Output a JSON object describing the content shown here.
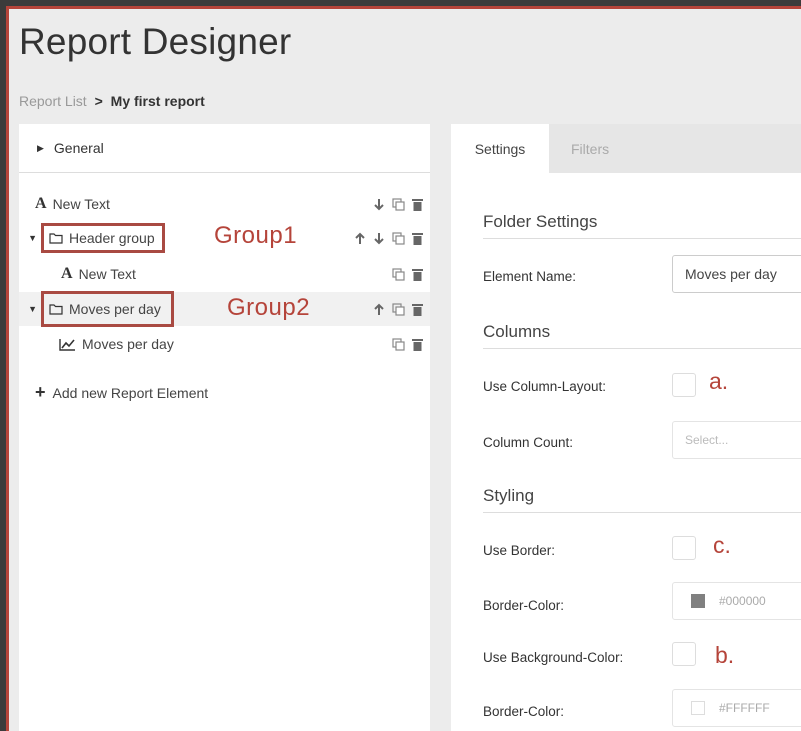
{
  "app": {
    "title": "Report Designer"
  },
  "breadcrumb": {
    "parent": "Report List",
    "separator": ">",
    "current": "My first report"
  },
  "tree": {
    "general_label": "General",
    "items": [
      {
        "label": "New Text",
        "icon": "text-icon"
      },
      {
        "label": "Header group",
        "icon": "folder-icon",
        "tag": "Group1"
      },
      {
        "label": "New Text",
        "icon": "text-icon"
      },
      {
        "label": "Moves per day",
        "icon": "folder-icon",
        "tag": "Group2"
      },
      {
        "label": "Moves per day",
        "icon": "line-chart-icon"
      }
    ],
    "add_label": "Add new Report Element"
  },
  "tabs": {
    "settings": "Settings",
    "filters": "Filters"
  },
  "settings": {
    "folder_heading": "Folder Settings",
    "element_name_label": "Element Name:",
    "element_name_value": "Moves per day",
    "columns_heading": "Columns",
    "use_column_layout_label": "Use Column-Layout:",
    "column_count_label": "Column Count:",
    "column_count_placeholder": "Select...",
    "styling_heading": "Styling",
    "use_border_label": "Use Border:",
    "border_color_label": "Border-Color:",
    "border_color_value": "#000000",
    "use_bg_label": "Use Background-Color:",
    "bg_color_label": "Border-Color:",
    "bg_color_value": "#FFFFFF"
  },
  "annotations": {
    "a": "a.",
    "b": "b.",
    "c": "c."
  },
  "colors": {
    "accent": "#b5443a",
    "border_swatch": "#808080",
    "bg_swatch": "#ffffff"
  }
}
